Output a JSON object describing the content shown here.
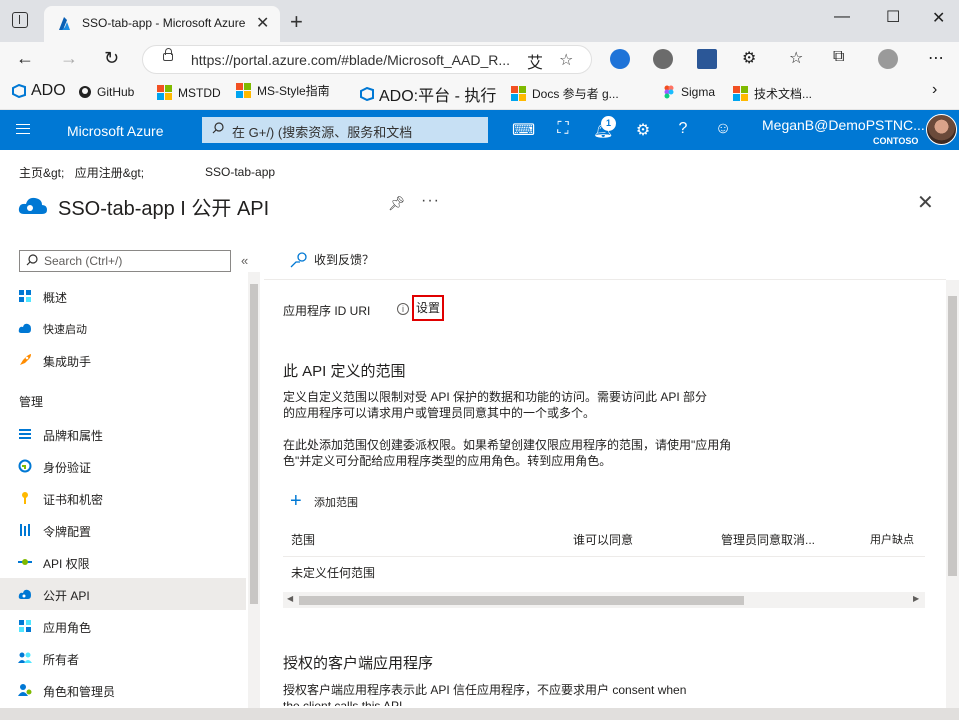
{
  "browser": {
    "tab_title": "SSO-tab-app - Microsoft Azure",
    "url": "https://portal.azure.com/#blade/Microsoft_AAD_R...",
    "url_ai": "艾",
    "favorites": [
      {
        "label": "ADO",
        "icon": "ado-icon"
      },
      {
        "label": "GitHub",
        "icon": "github-icon"
      },
      {
        "label": "MSTDD",
        "icon": "microsoft-icon"
      },
      {
        "label": "MS-Style指南",
        "icon": "microsoft-icon"
      },
      {
        "label": "ADO:平台 - 执行",
        "icon": "ado-icon"
      },
      {
        "label": "Docs 参与者 g...",
        "icon": "microsoft-icon"
      },
      {
        "label": "Sigma",
        "icon": "figma-icon"
      },
      {
        "label": "技术文档...",
        "icon": "microsoft-icon"
      }
    ]
  },
  "azure": {
    "brand": "Microsoft Azure",
    "search_placeholder": "在 G+/) (搜索资源、服务和文档",
    "notification_count": "1",
    "user": "MeganB@DemoPSTNC...",
    "tenant": "CONTOSO"
  },
  "breadcrumb": {
    "items": [
      "主页&gt;",
      "应用注册&gt;"
    ],
    "current": "SSO-tab-app"
  },
  "page": {
    "title": "SSO-tab-app I 公开 API"
  },
  "sidebar": {
    "search_placeholder": "Search (Ctrl+/)",
    "collapse": "«",
    "section_manage": "管理",
    "items": [
      {
        "label": "概述",
        "icon": "overview-icon"
      },
      {
        "label": "快速启动",
        "icon": "quickstart-icon"
      },
      {
        "label": "集成助手",
        "icon": "rocket-icon"
      },
      {
        "label": "品牌和属性",
        "icon": "branding-icon"
      },
      {
        "label": "身份验证",
        "icon": "authentication-icon"
      },
      {
        "label": "证书和机密",
        "icon": "key-icon"
      },
      {
        "label": "令牌配置",
        "icon": "token-icon"
      },
      {
        "label": "API 权限",
        "icon": "api-permissions-icon"
      },
      {
        "label": "公开 API",
        "icon": "expose-api-icon"
      },
      {
        "label": "应用角色",
        "icon": "app-roles-icon"
      },
      {
        "label": "所有者",
        "icon": "owners-icon"
      },
      {
        "label": "角色和管理员",
        "icon": "roles-admins-icon"
      }
    ]
  },
  "main": {
    "feedback": "收到反馈？",
    "app_id_uri_label": "应用程序 ID URI",
    "set_button": "设置",
    "scopes_heading": "此 API 定义的范围",
    "scopes_para1": "定义自定义范围以限制对受 API 保护的数据和功能的访问。需要访问此 API 部分的应用程序可以请求用户或管理员同意其中的一个或多个。",
    "scopes_para2": "在此处添加范围仅创建委派权限。如果希望创建仅限应用程序的范围，请使用\"应用角色\"并定义可分配给应用程序类型的应用角色。转到应用角色。",
    "add_scope": "添加范围",
    "table_headers": [
      "范围",
      "谁可以同意",
      "管理员同意取消...",
      "用户缺点"
    ],
    "empty_row": "未定义任何范围",
    "clients_heading": "授权的客户端应用程序",
    "clients_para": "授权客户端应用程序表示此 API 信任应用程序，不应要求用户 consent when the client calls this API."
  }
}
